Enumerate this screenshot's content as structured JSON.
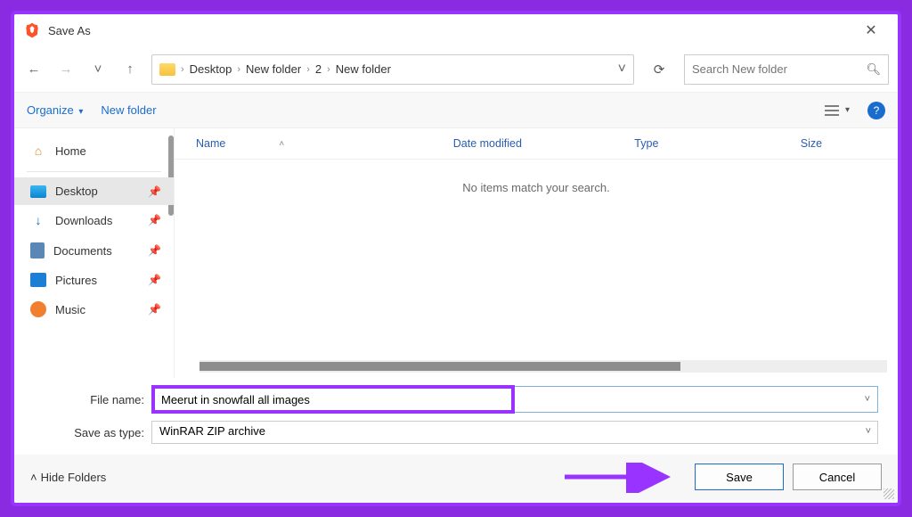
{
  "title": "Save As",
  "nav": {
    "back": "←",
    "fwd": "→",
    "recent": "˅",
    "up": "↑"
  },
  "breadcrumbs": [
    "Desktop",
    "New folder",
    "2",
    "New folder"
  ],
  "search_placeholder": "Search New folder",
  "toolbar": {
    "organize": "Organize",
    "newfolder": "New folder",
    "help": "?"
  },
  "columns": {
    "name": "Name",
    "date": "Date modified",
    "type": "Type",
    "size": "Size"
  },
  "empty_msg": "No items match your search.",
  "sidebar": {
    "home": "Home",
    "desktop": "Desktop",
    "downloads": "Downloads",
    "documents": "Documents",
    "pictures": "Pictures",
    "music": "Music"
  },
  "form": {
    "filename_label": "File name:",
    "filename_value": "Meerut in snowfall all images",
    "type_label": "Save as type:",
    "type_value": "WinRAR ZIP archive"
  },
  "footer": {
    "hide": "Hide Folders",
    "save": "Save",
    "cancel": "Cancel"
  }
}
